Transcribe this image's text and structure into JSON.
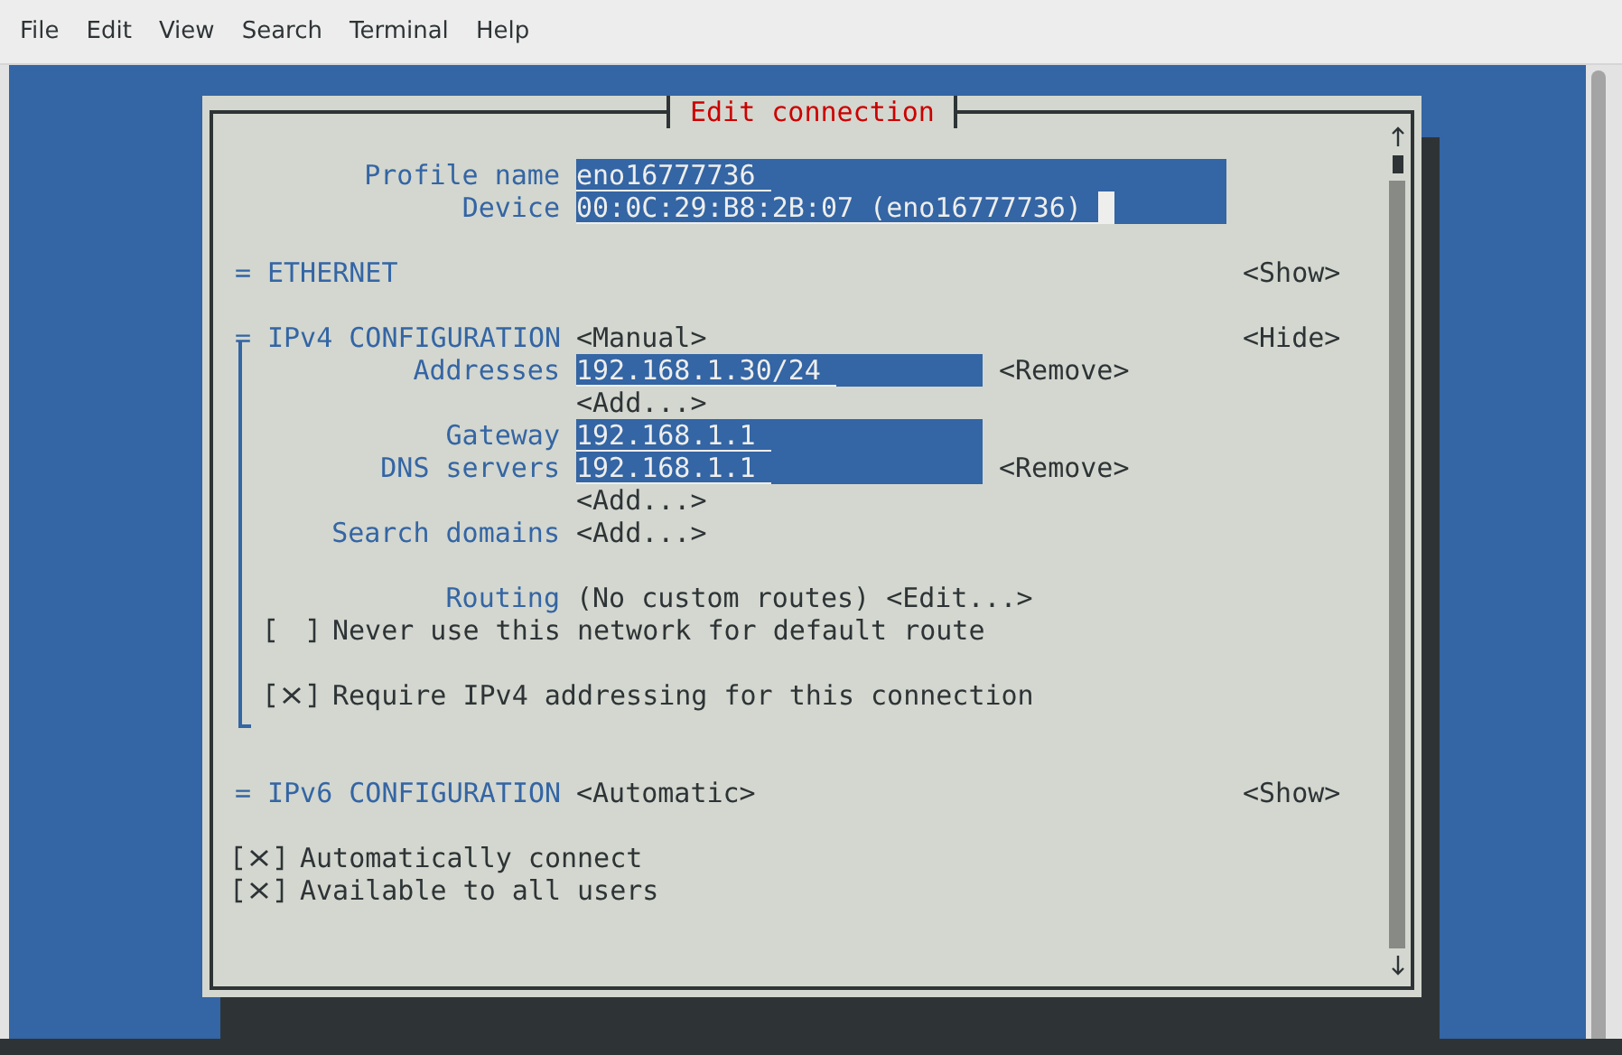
{
  "menu": [
    "File",
    "Edit",
    "View",
    "Search",
    "Terminal",
    "Help"
  ],
  "dialog": {
    "title": "Edit connection",
    "fields": [
      {
        "label": "Profile name",
        "value": "eno16777736",
        "focused": false
      },
      {
        "label": "Device",
        "value": "00:0C:29:B8:2B:07 (eno16777736)",
        "focused": true
      }
    ],
    "sections": [
      {
        "marker": "=",
        "name": "ETHERNET",
        "toggle": "<Show>"
      },
      {
        "marker": "=",
        "name": "IPv4 CONFIGURATION",
        "mode": "<Manual>",
        "toggle": "<Hide>",
        "rows": [
          {
            "kind": "field",
            "label": "Addresses",
            "value": "192.168.1.30/24",
            "action": "<Remove>"
          },
          {
            "kind": "button",
            "text": "<Add...>"
          },
          {
            "kind": "field",
            "label": "Gateway",
            "value": "192.168.1.1"
          },
          {
            "kind": "field",
            "label": "DNS servers",
            "value": "192.168.1.1",
            "action": "<Remove>"
          },
          {
            "kind": "button",
            "text": "<Add...>"
          },
          {
            "kind": "button",
            "label": "Search domains",
            "text": "<Add...>"
          },
          {
            "kind": "spacer"
          },
          {
            "kind": "info",
            "label": "Routing",
            "value": "(No custom routes)",
            "text": "<Edit...>"
          },
          {
            "kind": "checkbox",
            "label": "Never use this network for default route",
            "checked": false
          },
          {
            "kind": "spacer"
          },
          {
            "kind": "checkbox",
            "label": "Require IPv4 addressing for this connection",
            "checked": true
          }
        ]
      },
      {
        "marker": "=",
        "name": "IPv6 CONFIGURATION",
        "mode": "<Automatic>",
        "toggle": "<Show>"
      }
    ],
    "options": [
      {
        "label": "Automatically connect",
        "checked": true
      },
      {
        "label": "Available to all users",
        "checked": true
      }
    ]
  }
}
